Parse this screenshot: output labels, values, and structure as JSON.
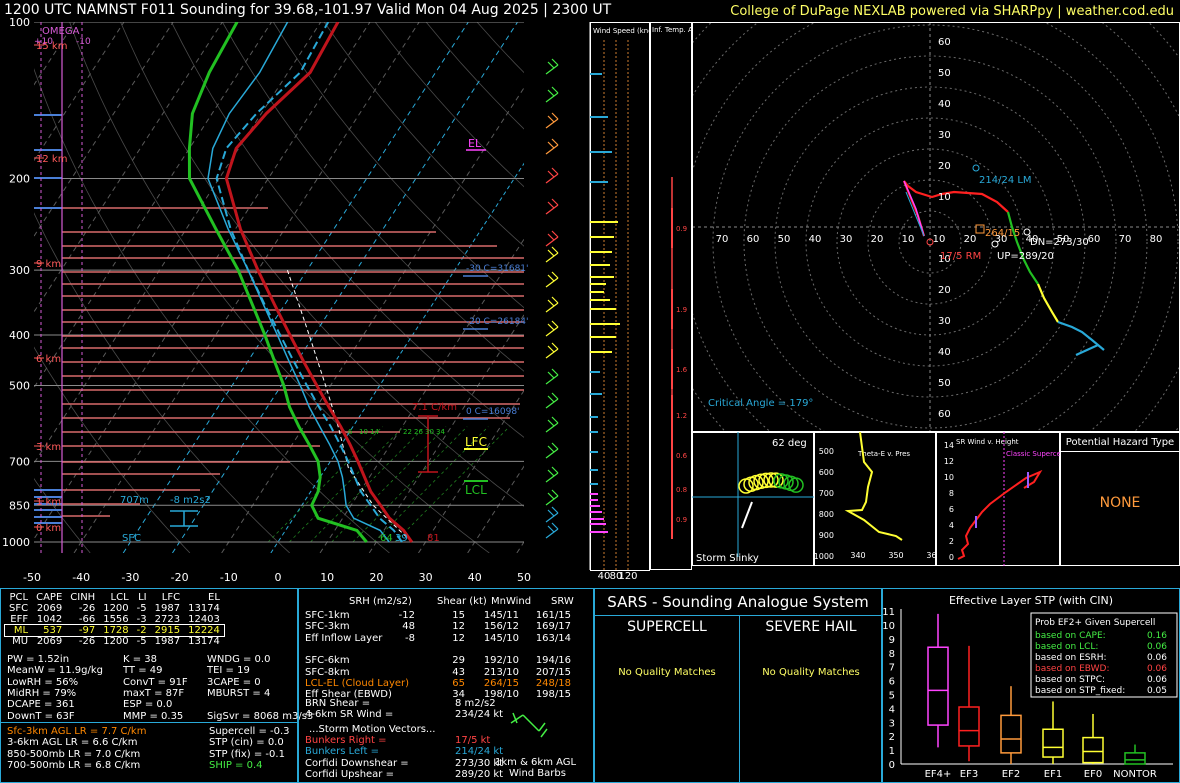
{
  "header": {
    "title": "1200 UTC NAMNST F011 Sounding for 39.68,-101.97 Valid  Mon 04 Aug 2025 | 2300 UT",
    "credit": "College of DuPage NEXLAB powered via SHARPpy | weather.cod.edu"
  },
  "chart_data": [
    {
      "type": "line",
      "name": "skewt",
      "pressure_ticks": [
        100,
        200,
        300,
        400,
        500,
        700,
        850,
        1000
      ],
      "temp_ticks": [
        -50,
        -40,
        -30,
        -20,
        -10,
        0,
        10,
        20,
        30,
        40,
        50
      ],
      "height_labels": [
        "15 km",
        "12 km",
        "9 km",
        "6 km",
        "3 km",
        "1 km",
        "0 km"
      ],
      "omega_label": "OMEGA",
      "omega_ticks": [
        "+10",
        "-10"
      ],
      "annotations": {
        "el": "EL",
        "lfc": "LFC",
        "lcl": "LCL",
        "lapse": "7.1 C/km",
        "wb_m30": "-30 C=31681'",
        "wb_m20": "-20 C=26184'",
        "wb_0": "0 C=16098'",
        "sfc": "SFC",
        "srh_depth": "707m",
        "srh_val": "-8 m2s2",
        "sfc_t": "81",
        "sfc_td": "64",
        "sfc_tw": "39",
        "mix_ticks": [
          "6",
          "10",
          "14",
          "22",
          "26",
          "30",
          "34"
        ]
      },
      "temperature": [
        [
          1000,
          27.2
        ],
        [
          950,
          24.0
        ],
        [
          900,
          19.5
        ],
        [
          850,
          16.0
        ],
        [
          800,
          12.2
        ],
        [
          750,
          9.0
        ],
        [
          700,
          5.6
        ],
        [
          650,
          1.8
        ],
        [
          600,
          -2.5
        ],
        [
          550,
          -7.5
        ],
        [
          500,
          -12.8
        ],
        [
          450,
          -18.6
        ],
        [
          400,
          -24.9
        ],
        [
          350,
          -32.0
        ],
        [
          300,
          -40.0
        ],
        [
          250,
          -49.0
        ],
        [
          200,
          -58.5
        ],
        [
          175,
          -60.5
        ],
        [
          150,
          -59.0
        ],
        [
          125,
          -55.5
        ],
        [
          100,
          -56.5
        ]
      ],
      "dewpoint": [
        [
          1000,
          18.0
        ],
        [
          950,
          14.5
        ],
        [
          900,
          5.0
        ],
        [
          850,
          2.0
        ],
        [
          800,
          1.5
        ],
        [
          750,
          0.0
        ],
        [
          700,
          -2.5
        ],
        [
          650,
          -6.5
        ],
        [
          600,
          -11.0
        ],
        [
          550,
          -15.5
        ],
        [
          500,
          -19.5
        ],
        [
          450,
          -24.5
        ],
        [
          400,
          -30.0
        ],
        [
          350,
          -36.5
        ],
        [
          300,
          -44.0
        ],
        [
          250,
          -54.0
        ],
        [
          200,
          -66.0
        ],
        [
          175,
          -70.0
        ],
        [
          150,
          -74.0
        ],
        [
          125,
          -76.0
        ],
        [
          100,
          -77.0
        ]
      ],
      "parcel": [
        [
          1000,
          27.2
        ],
        [
          850,
          14.5
        ],
        [
          720,
          4.5
        ],
        [
          600,
          -3.0
        ],
        [
          500,
          -11.0
        ],
        [
          400,
          -21.0
        ],
        [
          300,
          -34.0
        ]
      ]
    },
    {
      "type": "bar",
      "name": "wind-speed",
      "title": "Wind Speed (knots)",
      "ticks": [
        "40",
        "80",
        "120"
      ]
    },
    {
      "type": "line",
      "name": "inferred-temp-advection",
      "title": "Inf. Temp. Adv. (C/hr)",
      "values": [
        0.9,
        1.9,
        1.6,
        1.2,
        0.6,
        0.8,
        0.9
      ]
    },
    {
      "type": "line",
      "name": "hodograph",
      "ring_labels": [
        "10",
        "20",
        "30",
        "40",
        "50",
        "60"
      ],
      "x_labels": [
        "70",
        "60",
        "50",
        "40",
        "30",
        "20",
        "10",
        "10",
        "20",
        "30",
        "40",
        "50",
        "60",
        "70",
        "80"
      ],
      "labels": {
        "lm": "214/24 LM",
        "rm": "17/5 RM",
        "mean": "264/15",
        "dn": "DN=273/30",
        "up": "UP=289/20",
        "crit": "Critical Angle = 179°"
      }
    },
    {
      "type": "line",
      "name": "storm-slinky",
      "title": "Storm Slinky",
      "angle": "62 deg"
    },
    {
      "type": "line",
      "name": "theta-e",
      "title": "Theta-E v. Pres",
      "y_ticks": [
        "500",
        "600",
        "700",
        "800",
        "900",
        "1000"
      ],
      "x_ticks": [
        "340",
        "350",
        "360"
      ]
    },
    {
      "type": "line",
      "name": "sr-wind",
      "title": "SR Wind v. Height",
      "label": "Classic Supercell",
      "y_ticks": [
        "14",
        "12",
        "10",
        "8",
        "6",
        "4",
        "2",
        "0"
      ]
    },
    {
      "type": "bar",
      "name": "stp-boxplot",
      "title": "Effective Layer STP (with CIN)",
      "categories": [
        "EF4+",
        "EF3",
        "EF2",
        "EF1",
        "EF0",
        "NONTOR"
      ],
      "y_ticks": [
        "11",
        "10",
        "9",
        "8",
        "7",
        "6",
        "5",
        "4",
        "3",
        "2",
        "1",
        "0"
      ],
      "legend_title": "Prob EF2+ Given Supercell",
      "legend": [
        {
          "label": "based on CAPE:",
          "value": "0.16",
          "color": "#44ee44"
        },
        {
          "label": "based on LCL:",
          "value": "0.06",
          "color": "#44ee44"
        },
        {
          "label": "based on ESRH:",
          "value": "0.06",
          "color": "#ffffff"
        },
        {
          "label": "based on EBWD:",
          "value": "0.06",
          "color": "#ff4444"
        },
        {
          "label": "based on STPC:",
          "value": "0.06",
          "color": "#ffffff"
        },
        {
          "label": "based on STP_fixed:",
          "value": "0.05",
          "color": "#ffffff"
        }
      ]
    }
  ],
  "hazard": {
    "title": "Potential Hazard Type",
    "value": "NONE"
  },
  "parcels": {
    "headers": [
      "PCL",
      "CAPE",
      "CINH",
      "LCL",
      "LI",
      "LFC",
      "EL"
    ],
    "rows": [
      [
        "SFC",
        "2069",
        "-26",
        "1200",
        "-5",
        "1987",
        "13174"
      ],
      [
        "EFF",
        "1042",
        "-66",
        "1556",
        "-3",
        "2723",
        "12403"
      ],
      [
        "ML",
        "537",
        "-97",
        "1728",
        "-2",
        "2915",
        "12224"
      ],
      [
        "MU",
        "2069",
        "-26",
        "1200",
        "-5",
        "1987",
        "13174"
      ]
    ]
  },
  "thermo": [
    [
      "PW = 1.52in",
      "K = 38",
      "WNDG = 0.0"
    ],
    [
      "MeanW = 11.9g/kg",
      "TT = 49",
      "TEI = 19"
    ],
    [
      "LowRH = 56%",
      "ConvT = 91F",
      "3CAPE = 0"
    ],
    [
      "MidRH = 79%",
      "maxT = 87F",
      "MBURST = 4"
    ],
    [
      "DCAPE = 361",
      "ESP = 0.0",
      ""
    ],
    [
      "DownT = 63F",
      "MMP = 0.35",
      "SigSvr = 8068 m3/s3"
    ]
  ],
  "lapse_rates": [
    {
      "text": "Sfc-3km AGL LR = 7.7 C/km",
      "color": "#ff8800"
    },
    {
      "text": "3-6km AGL LR = 6.6 C/km",
      "color": "#ffffff"
    },
    {
      "text": "850-500mb LR = 7.0 C/km",
      "color": "#ffffff"
    },
    {
      "text": "700-500mb LR = 6.8 C/km",
      "color": "#ffffff"
    }
  ],
  "composite": [
    {
      "text": "Supercell = -0.3",
      "color": "#ffffff"
    },
    {
      "text": "STP (cin) = 0.0",
      "color": "#ffffff"
    },
    {
      "text": "STP (fix) = -0.1",
      "color": "#ffffff"
    },
    {
      "text": "SHIP = 0.4",
      "color": "#44ee44"
    }
  ],
  "kinematics": {
    "headers": [
      "SRH (m2/s2)",
      "Shear (kt)",
      "MnWind",
      "SRW"
    ],
    "rows": [
      {
        "label": "SFC-1km",
        "srh": "-12",
        "shear": "15",
        "mn": "145/11",
        "srw": "161/15",
        "color": "#ffffff"
      },
      {
        "label": "SFC-3km",
        "srh": "48",
        "shear": "12",
        "mn": "156/12",
        "srw": "169/17",
        "color": "#ffffff"
      },
      {
        "label": "Eff Inflow Layer",
        "srh": "-8",
        "shear": "12",
        "mn": "145/10",
        "srw": "163/14",
        "color": "#ffffff"
      },
      {
        "label": "",
        "srh": "",
        "shear": "",
        "mn": "",
        "srw": "",
        "color": "#ffffff"
      },
      {
        "label": "SFC-6km",
        "srh": "",
        "shear": "29",
        "mn": "192/10",
        "srw": "194/16",
        "color": "#ffffff"
      },
      {
        "label": "SFC-8km",
        "srh": "",
        "shear": "43",
        "mn": "213/10",
        "srw": "207/15",
        "color": "#ffffff"
      },
      {
        "label": "LCL-EL (Cloud Layer)",
        "srh": "",
        "shear": "65",
        "mn": "264/15",
        "srw": "248/18",
        "color": "#ff8800"
      },
      {
        "label": "Eff Shear (EBWD)",
        "srh": "",
        "shear": "34",
        "mn": "198/10",
        "srw": "198/15",
        "color": "#ffffff"
      }
    ],
    "brn_label": "BRN Shear =",
    "brn_val": "8 m2/s2",
    "srw46_label": "4-6km SR Wind =",
    "srw46_val": "234/24 kt",
    "storm_title": "...Storm Motion Vectors...",
    "storm": [
      {
        "label": "Bunkers Right =",
        "val": "17/5 kt",
        "color": "#ff4444"
      },
      {
        "label": "Bunkers Left =",
        "val": "214/24 kt",
        "color": "#29a9d8"
      },
      {
        "label": "Corfidi Downshear =",
        "val": "273/30 kt",
        "color": "#ffffff"
      },
      {
        "label": "Corfidi Upshear =",
        "val": "289/20 kt",
        "color": "#ffffff"
      }
    ],
    "barb_label1": "1km & 6km AGL",
    "barb_label2": "Wind Barbs"
  },
  "sars": {
    "title": "SARS - Sounding Analogue System",
    "supercell_title": "SUPERCELL",
    "hail_title": "SEVERE HAIL",
    "supercell_msg": "No Quality Matches",
    "hail_msg": "No Quality Matches"
  }
}
